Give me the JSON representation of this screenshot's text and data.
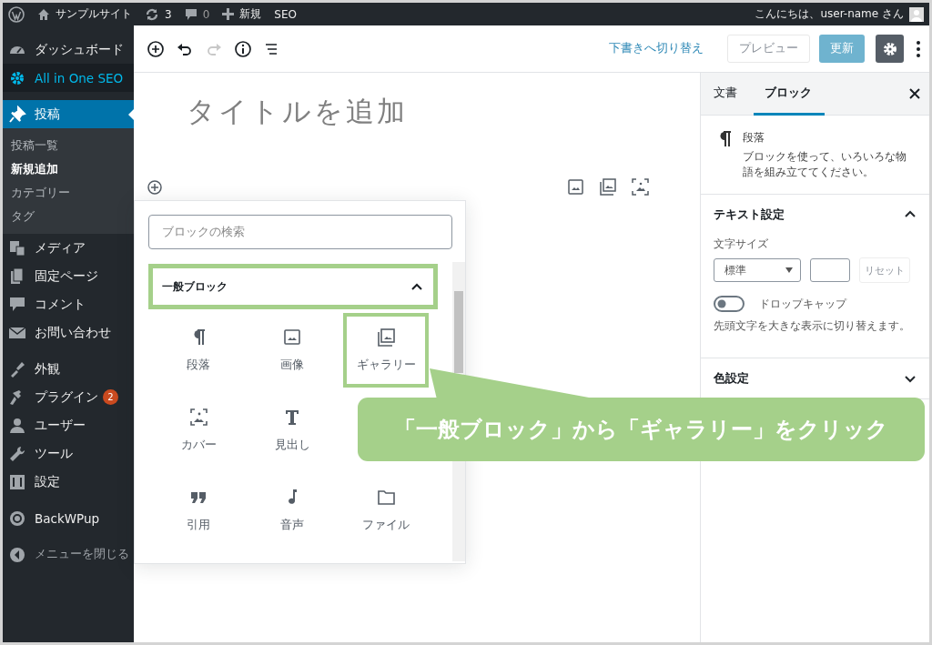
{
  "admin_bar": {
    "site_name": "サンプルサイト",
    "updates_count": "3",
    "comments_count": "0",
    "new_label": "新規",
    "seo_label": "SEO",
    "greeting": "こんにちは、user-name さん"
  },
  "admin_menu": {
    "groups": [
      {
        "items": [
          {
            "label": "ダッシュボード",
            "selected": false,
            "hovered": false
          },
          {
            "label": "All in One SEO",
            "selected": false,
            "hovered": true
          }
        ]
      },
      {
        "items": [
          {
            "label": "投稿",
            "selected": true,
            "hovered": false,
            "children": [
              {
                "label": "投稿一覧",
                "selected": false
              },
              {
                "label": "新規追加",
                "selected": true
              },
              {
                "label": "カテゴリー",
                "selected": false
              },
              {
                "label": "タグ",
                "selected": false
              }
            ]
          },
          {
            "label": "メディア",
            "selected": false,
            "hovered": false
          },
          {
            "label": "固定ページ",
            "selected": false,
            "hovered": false
          },
          {
            "label": "コメント",
            "selected": false,
            "hovered": false
          },
          {
            "label": "お問い合わせ",
            "selected": false,
            "hovered": false
          }
        ]
      },
      {
        "items": [
          {
            "label": "外観",
            "selected": false,
            "hovered": false
          },
          {
            "label": "プラグイン",
            "selected": false,
            "hovered": false,
            "badge": "2"
          },
          {
            "label": "ユーザー",
            "selected": false,
            "hovered": false
          },
          {
            "label": "ツール",
            "selected": false,
            "hovered": false
          },
          {
            "label": "設定",
            "selected": false,
            "hovered": false
          }
        ]
      },
      {
        "items": [
          {
            "label": "BackWPup",
            "selected": false,
            "hovered": false
          }
        ]
      }
    ],
    "collapse_label": "メニューを閉じる"
  },
  "editor": {
    "toolbar": {
      "redo_disabled": true,
      "switch_to_draft": "下書きへ切り替え",
      "preview": "プレビュー",
      "preview_disabled": true,
      "update": "更新",
      "update_disabled": true,
      "settings_selected": true
    },
    "title_placeholder": "タイトルを追加"
  },
  "inserter": {
    "search_placeholder": "ブロックの検索",
    "category": {
      "label": "一般ブロック",
      "expanded": true,
      "highlighted": true
    },
    "blocks": [
      {
        "label": "段落",
        "highlighted": false
      },
      {
        "label": "画像",
        "highlighted": false
      },
      {
        "label": "ギャラリー",
        "highlighted": true
      },
      {
        "label": "カバー",
        "highlighted": false
      },
      {
        "label": "見出し",
        "highlighted": false
      },
      {
        "label": "引用",
        "highlighted": false
      },
      {
        "label": "音声",
        "highlighted": false
      },
      {
        "label": "ファイル",
        "highlighted": false
      }
    ]
  },
  "settings_panel": {
    "tabs": [
      {
        "label": "文書",
        "selected": false
      },
      {
        "label": "ブロック",
        "selected": true
      }
    ],
    "block": {
      "name": "段落",
      "description": "ブロックを使って、いろいろな物語を組み立ててください。"
    },
    "text_settings": {
      "title": "テキスト設定",
      "expanded": true,
      "font_size_label": "文字サイズ",
      "font_size_value": "標準",
      "reset": "リセット",
      "reset_disabled": true,
      "drop_cap_label": "ドロップキャップ",
      "drop_cap_on": false,
      "drop_cap_help": "先頭文字を大きな表示に切り替えます。"
    },
    "color_settings": {
      "title": "色設定",
      "expanded": false
    }
  },
  "callout": {
    "text": "「一般ブロック」から「ギャラリー」をクリック"
  }
}
